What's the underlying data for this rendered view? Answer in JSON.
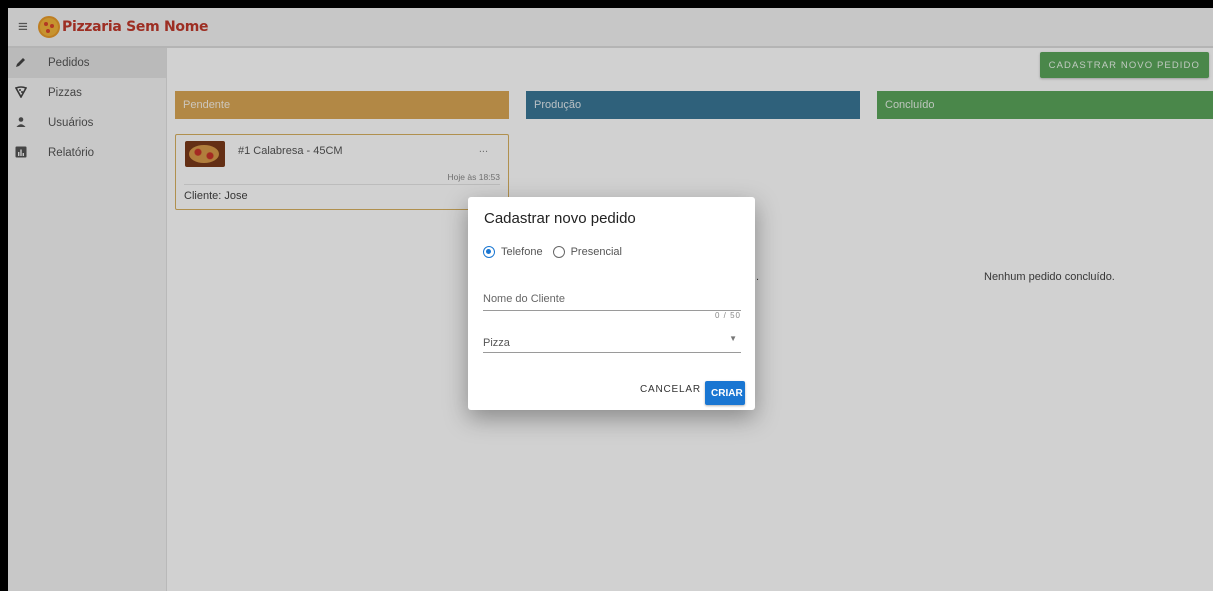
{
  "app": {
    "brand": "Pizzaria Sem Nome"
  },
  "sidebar": {
    "items": [
      {
        "label": "Pedidos",
        "icon": "pencil-icon",
        "active": true
      },
      {
        "label": "Pizzas",
        "icon": "pizza-icon"
      },
      {
        "label": "Usuários",
        "icon": "user-icon"
      },
      {
        "label": "Relatório",
        "icon": "chart-icon"
      }
    ]
  },
  "main": {
    "new_order_button": "CADASTRAR NOVO PEDIDO",
    "columns": [
      {
        "title": "Pendente",
        "color": "#d9a755"
      },
      {
        "title": "Produção",
        "color": "#3a7796"
      },
      {
        "title": "Concluído",
        "color": "#5ba55b"
      }
    ],
    "card": {
      "title": "#1 Calabresa - 45CM",
      "menu": "...",
      "time": "Hoje às 18:53",
      "client": "Cliente: Jose"
    },
    "empty_production_tail": ".",
    "empty_done": "Nenhum pedido concluído."
  },
  "dialog": {
    "title": "Cadastrar novo pedido",
    "radio_options": [
      "Telefone",
      "Presencial"
    ],
    "selected_option": "Telefone",
    "client_name_placeholder": "Nome do Cliente",
    "client_name_value": "",
    "counter": "0 / 50",
    "pizza_label": "Pizza",
    "cancel_label": "CANCELAR",
    "create_label": "CRIAR"
  }
}
